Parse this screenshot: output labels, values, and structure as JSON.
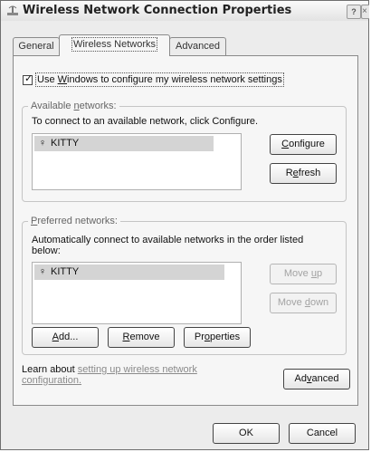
{
  "window": {
    "title": "Wireless Network Connection Properties",
    "help_glyph": "?",
    "close_glyph": "×"
  },
  "tabs": [
    {
      "label": "General"
    },
    {
      "label": "Wireless Networks"
    },
    {
      "label": "Advanced"
    }
  ],
  "use_windows": {
    "pre": "Use ",
    "accel": "W",
    "post": "indows to configure my wireless network settings",
    "checked": true,
    "check_glyph": "✓"
  },
  "available": {
    "legend_pre": "Available ",
    "legend_accel": "n",
    "legend_post": "etworks:",
    "description": "To connect to an available network, click Configure.",
    "items": [
      {
        "name": "KITTY",
        "icon": "antenna-icon"
      }
    ],
    "configure": {
      "accel": "C",
      "rest": "onfigure"
    },
    "refresh": {
      "pre": "R",
      "accel": "e",
      "post": "fresh"
    }
  },
  "preferred": {
    "legend_accel": "P",
    "legend_rest": "referred networks:",
    "description_line1": "Automatically connect to available networks in the order listed",
    "description_line2": "below:",
    "items": [
      {
        "name": "KITTY",
        "icon": "antenna-icon"
      }
    ],
    "move_up": {
      "pre": "Move ",
      "accel": "u",
      "post": "p",
      "disabled": true
    },
    "move_down": {
      "pre": "Move ",
      "accel": "d",
      "post": "own",
      "disabled": true
    },
    "add": {
      "accel": "A",
      "rest": "dd..."
    },
    "remove": {
      "accel": "R",
      "rest": "emove"
    },
    "properties": {
      "pre": "Pr",
      "accel": "o",
      "post": "perties"
    }
  },
  "learn": {
    "prefix": "Learn about ",
    "link_line1": "setting up wireless network",
    "link_line2": "configuration."
  },
  "advanced_button": {
    "pre": "Ad",
    "accel": "v",
    "post": "anced"
  },
  "ok_label": "OK",
  "cancel_label": "Cancel",
  "antenna_glyph": "♀"
}
